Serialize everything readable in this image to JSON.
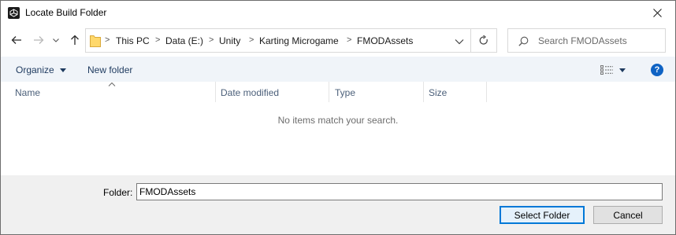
{
  "window": {
    "title": "Locate Build Folder",
    "app_icon": "unity-icon",
    "close_icon": "close-icon"
  },
  "nav": {
    "back_icon": "arrow-left-icon",
    "forward_icon": "arrow-right-icon",
    "recent_icon": "chevron-down-icon",
    "up_icon": "arrow-up-icon",
    "breadcrumb": [
      "This PC",
      "Data (E:)",
      "Unity",
      "Karting Microgame",
      "FMODAssets"
    ],
    "separator": ">",
    "refresh_icon": "refresh-icon"
  },
  "search": {
    "placeholder": "Search FMODAssets",
    "value": ""
  },
  "toolbar": {
    "organize_label": "Organize",
    "new_folder_label": "New folder",
    "view_icon": "details-view-icon",
    "help_label": "?"
  },
  "columns": [
    "Name",
    "Date modified",
    "Type",
    "Size"
  ],
  "empty_message": "No items match your search.",
  "footer": {
    "folder_label": "Folder:",
    "folder_value": "FMODAssets",
    "select_button": "Select Folder",
    "cancel_button": "Cancel"
  },
  "colors": {
    "accent": "#0078d7",
    "help_blue": "#0f63c4",
    "toolbar_bg": "#f0f4f9",
    "footer_bg": "#f0f0f0"
  }
}
